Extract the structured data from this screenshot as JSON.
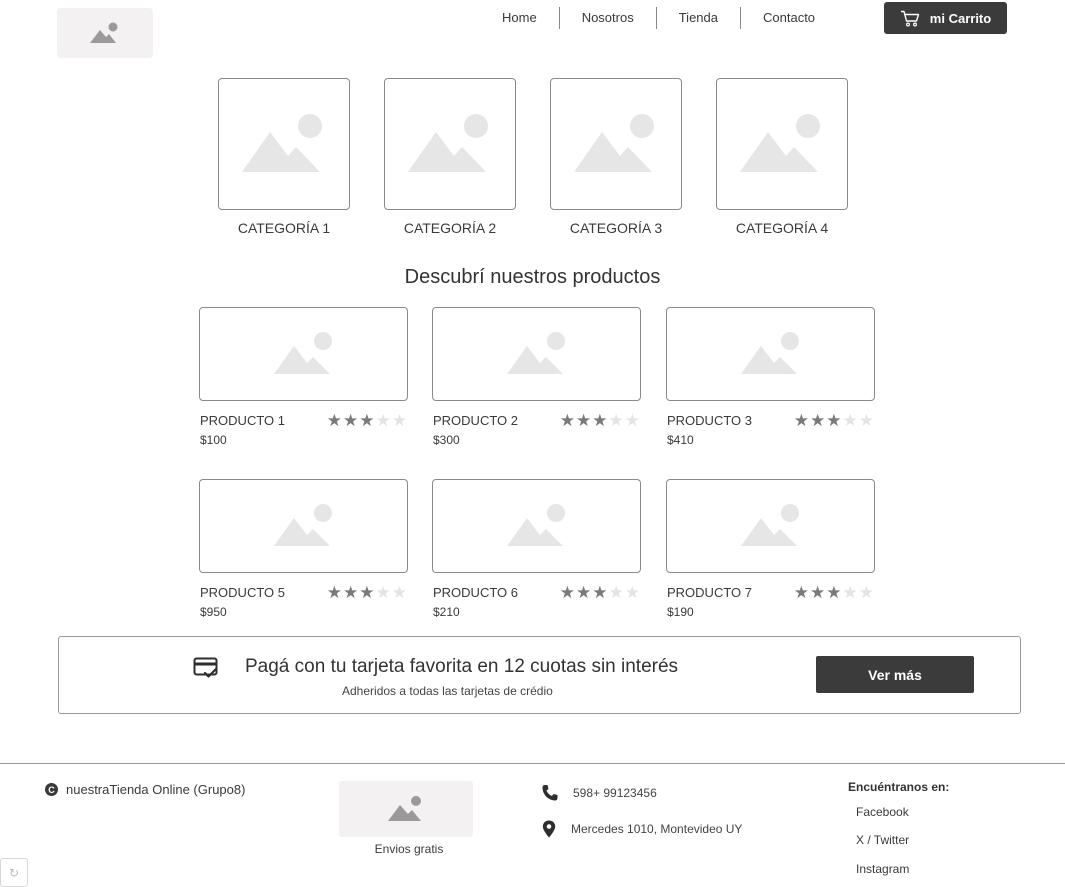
{
  "header": {
    "logo_icon": "image-placeholder-icon",
    "nav": [
      "Home",
      "Nosotros",
      "Tienda",
      "Contacto"
    ],
    "cart_label": "mi Carrito",
    "cart_icon": "shopping-cart-icon"
  },
  "categories": [
    {
      "label": "CATEGORÍA 1"
    },
    {
      "label": "CATEGORÍA 2"
    },
    {
      "label": "CATEGORÍA 3"
    },
    {
      "label": "CATEGORÍA 4"
    }
  ],
  "products_section": {
    "title": "Descubrí nuestros productos",
    "items": [
      {
        "name": "PRODUCTO 1",
        "price": "$100",
        "rating": 3,
        "max_rating": 5
      },
      {
        "name": "PRODUCTO 2",
        "price": "$300",
        "rating": 3,
        "max_rating": 5
      },
      {
        "name": "PRODUCTO 3",
        "price": "$410",
        "rating": 3,
        "max_rating": 5
      },
      {
        "name": "PRODUCTO 5",
        "price": "$950",
        "rating": 3,
        "max_rating": 5
      },
      {
        "name": "PRODUCTO 6",
        "price": "$210",
        "rating": 3,
        "max_rating": 5
      },
      {
        "name": "PRODUCTO 7",
        "price": "$190",
        "rating": 3,
        "max_rating": 5
      }
    ]
  },
  "promo": {
    "icon": "credit-card-check-icon",
    "title": "Pagá con tu tarjeta favorita en 12 cuotas sin interés",
    "subtitle": "Adheridos a todas las tarjetas de crédio",
    "button": "Ver más"
  },
  "footer": {
    "copyright": "nuestraTienda Online (Grupo8)",
    "image_label": "Envios gratis",
    "phone": "598+ 99123456",
    "address": "Mercedes 1010, Montevideo UY",
    "social_title": "Encuéntranos en:",
    "social": [
      "Facebook",
      "X / Twitter",
      "Instagram"
    ]
  },
  "colors": {
    "dark_button": "#3b3b3b",
    "border": "#8a8a8a",
    "placeholder_fill": "#e6e6e6",
    "star_on": "#7a7a7a",
    "star_off": "#e4e4e4"
  }
}
